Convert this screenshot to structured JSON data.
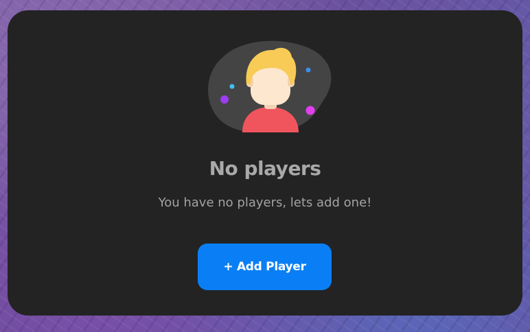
{
  "empty_state": {
    "illustration_icon": "avatar-placeholder-icon",
    "title": "No players",
    "message": "You have no players, lets add one!",
    "add_button_label": "+ Add Player"
  },
  "colors": {
    "card_background": "#232323",
    "button_background": "#0a7ff5",
    "button_text": "#ffffff",
    "title_text": "#a9a9a9",
    "message_text": "#a3a3a3",
    "blob": "#444444",
    "hair": "#f8cb57",
    "face": "#fde7cf",
    "shirt": "#f0555e",
    "dot_purple": "#9d3df2",
    "dot_magenta": "#e23ff0",
    "dot_blue": "#3d8ef5",
    "dot_cyan": "#3fc0f0"
  }
}
